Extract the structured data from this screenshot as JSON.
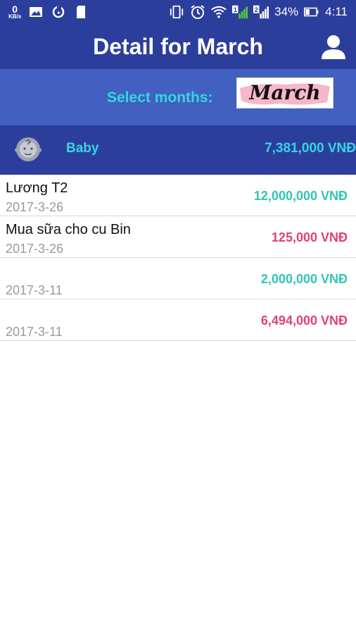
{
  "status_bar": {
    "speed_value": "0",
    "speed_unit": "KB/s",
    "battery": "34%",
    "time": "4:11",
    "signal_sim1": "1",
    "signal_sim2": "2"
  },
  "header": {
    "title": "Detail for March"
  },
  "month_selector": {
    "label": "Select months:",
    "selected": "March"
  },
  "category": {
    "name": "Baby",
    "total": "7,381,000 VNĐ"
  },
  "transactions": [
    {
      "name": "Lương T2",
      "date": "2017-3-26",
      "amount": "12,000,000 VNĐ",
      "type": "income"
    },
    {
      "name": "Mua sữa cho cu Bin",
      "date": "2017-3-26",
      "amount": "125,000 VNĐ",
      "type": "expense"
    },
    {
      "name": "",
      "date": "2017-3-11",
      "amount": "2,000,000 VNĐ",
      "type": "income"
    },
    {
      "name": "",
      "date": "2017-3-11",
      "amount": "6,494,000 VNĐ",
      "type": "expense"
    }
  ],
  "colors": {
    "primary": "#2c3e9c",
    "secondary": "#4160c0",
    "accent_cyan": "#36d6e0",
    "income": "#2fc7b3",
    "expense": "#e03f7c"
  }
}
